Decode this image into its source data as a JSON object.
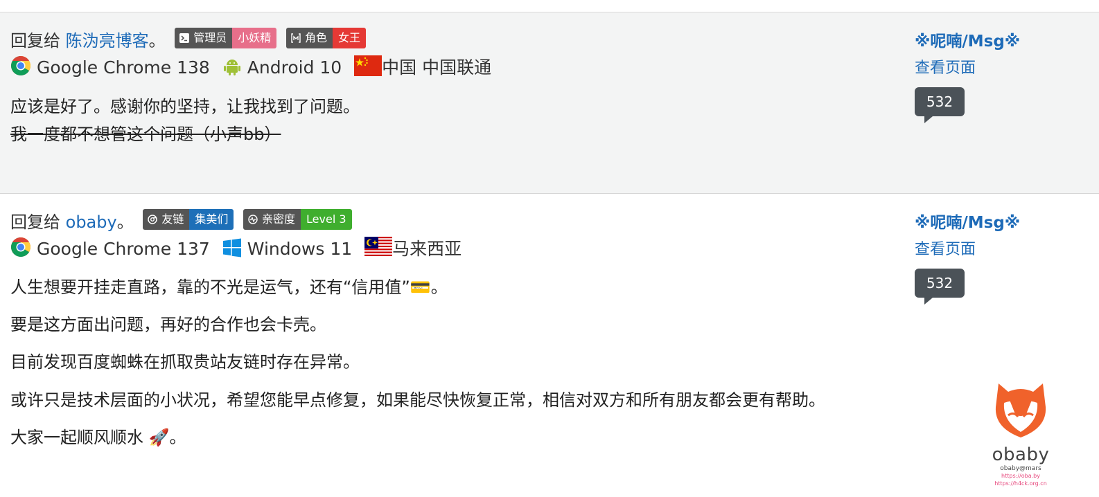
{
  "comments": [
    {
      "reply_prefix": "回复给",
      "reply_to": "陈沩亮博客",
      "reply_suffix": "。",
      "badges": [
        {
          "icon": "terminal-icon",
          "label": "管理员",
          "value": "小妖精",
          "color": "#e76f8a"
        },
        {
          "icon": "bracket-m-icon",
          "label": "角色",
          "value": "女王",
          "color": "#e53935"
        }
      ],
      "browser": "Google Chrome 138",
      "os": "Android 10",
      "os_icon": "android-icon",
      "flag": "china-flag-icon",
      "location": "中国 中国联通",
      "body": [
        "应该是好了。感谢你的坚持，让我找到了问题。"
      ],
      "struck": "我一度都不想管这个问题（小声bb）",
      "author": "※呢喃/Msg※",
      "view_page": "查看页面",
      "count": "532"
    },
    {
      "reply_prefix": "回复给",
      "reply_to": "obaby",
      "reply_suffix": "。",
      "badges": [
        {
          "icon": "chrome-small-icon",
          "label": "友链",
          "value": "集美们",
          "color": "#1d6fb8"
        },
        {
          "icon": "pulse-icon",
          "label": "亲密度",
          "value": "Level 3",
          "color": "#3fae2e"
        }
      ],
      "browser": "Google Chrome 137",
      "os": "Windows 11",
      "os_icon": "windows-icon",
      "flag": "malaysia-flag-icon",
      "location": "马来西亚",
      "body": [
        "人生想要开挂走直路，靠的不光是运气，还有“信用值”💳。",
        "要是这方面出问题，再好的合作也会卡壳。",
        "目前发现百度蜘蛛在抓取贵站友链时存在异常。",
        "或许只是技术层面的小状况，希望您能早点修复，如果能尽快恢复正常，相信对双方和所有朋友都会更有帮助。",
        "大家一起顺风顺水 🚀。"
      ],
      "author": "※呢喃/Msg※",
      "view_page": "查看页面",
      "count": "532"
    }
  ],
  "stamp": {
    "brand": "obaby",
    "handle": "obaby@mars",
    "url1": "https://oba.by",
    "url2": "https://h4ck.org.cn"
  }
}
